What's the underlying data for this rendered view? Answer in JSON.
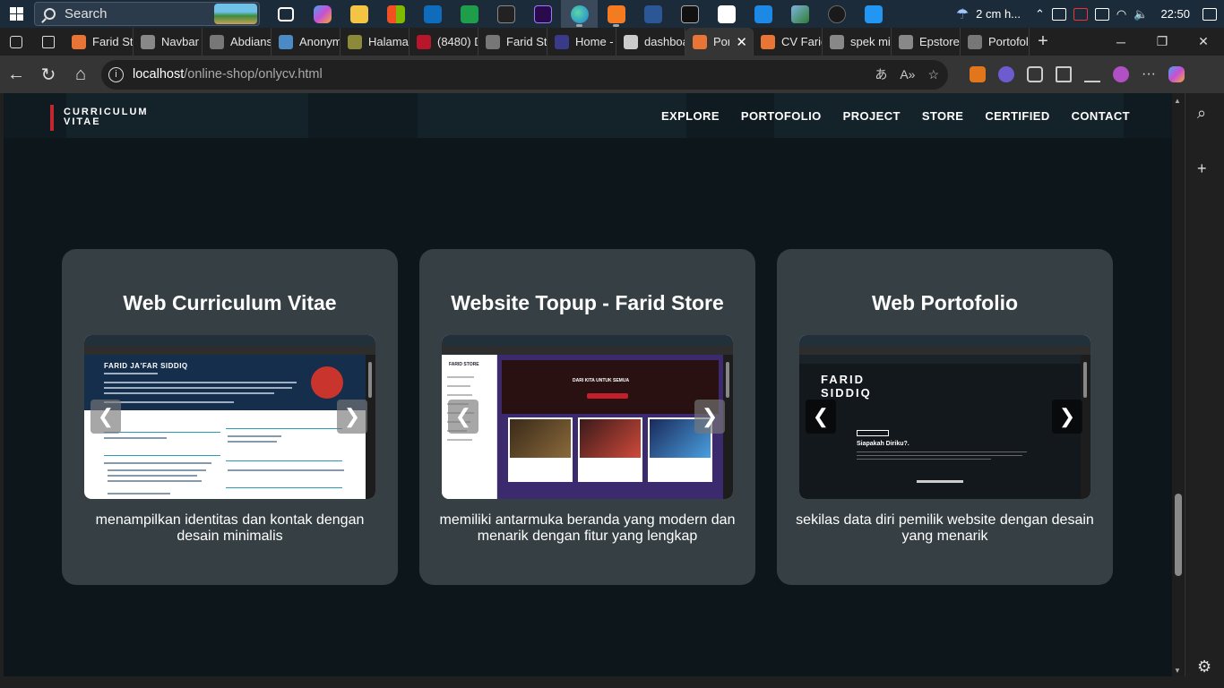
{
  "taskbar": {
    "search_placeholder": "Search",
    "weather": "2 cm h...",
    "time": "22:50"
  },
  "tabs": [
    {
      "label": "Farid St",
      "color": "#e87535"
    },
    {
      "label": "Navbar",
      "color": "#888888"
    },
    {
      "label": "Abdians",
      "color": "#777777"
    },
    {
      "label": "Anonym",
      "color": "#4a8bc6"
    },
    {
      "label": "Halama",
      "color": "#8a8a3a"
    },
    {
      "label": "(8480) D",
      "color": "#b8162a"
    },
    {
      "label": "Farid St",
      "color": "#777777"
    },
    {
      "label": "Home -",
      "color": "#3a3a8a"
    },
    {
      "label": "dashboa",
      "color": "#cccccc"
    },
    {
      "label": "Por",
      "color": "#e87535",
      "active": true
    },
    {
      "label": "CV Farid",
      "color": "#e87535"
    },
    {
      "label": "spek mi",
      "color": "#888888"
    },
    {
      "label": "Epstore",
      "color": "#888888"
    },
    {
      "label": "Portofol",
      "color": "#777777"
    }
  ],
  "address": {
    "host": "localhost",
    "path": "/online-shop/onlycv.html"
  },
  "page": {
    "brand_line1": "CURRICULUM",
    "brand_line2": "VITAE",
    "menu": [
      "EXPLORE",
      "PORTOFOLIO",
      "PROJECT",
      "STORE",
      "CERTIFIED",
      "CONTACT"
    ],
    "cards": [
      {
        "title": "Web Curriculum Vitae",
        "desc": "menampilkan identitas dan kontak dengan desain minimalis",
        "shot_heading": "FARID JA'FAR SIDDIQ"
      },
      {
        "title": "Website Topup - Farid Store",
        "desc": "memiliki antarmuka beranda yang modern dan menarik dengan fitur yang lengkap",
        "shot_heading": "DARI KITA UNTUK SEMUA",
        "shot_brand": "FARID STORE"
      },
      {
        "title": "Web Portofolio",
        "desc": "sekilas data diri pemilik website dengan desain yang menarik",
        "shot_heading": "FARID SIDDIQ",
        "shot_question": "Siapakah Diriku?."
      }
    ],
    "prev_glyph": "❮",
    "next_glyph": "❯"
  },
  "colors": {
    "page_bg": "#0d161b",
    "card_bg": "#364044",
    "brand_accent": "#c2272d"
  }
}
